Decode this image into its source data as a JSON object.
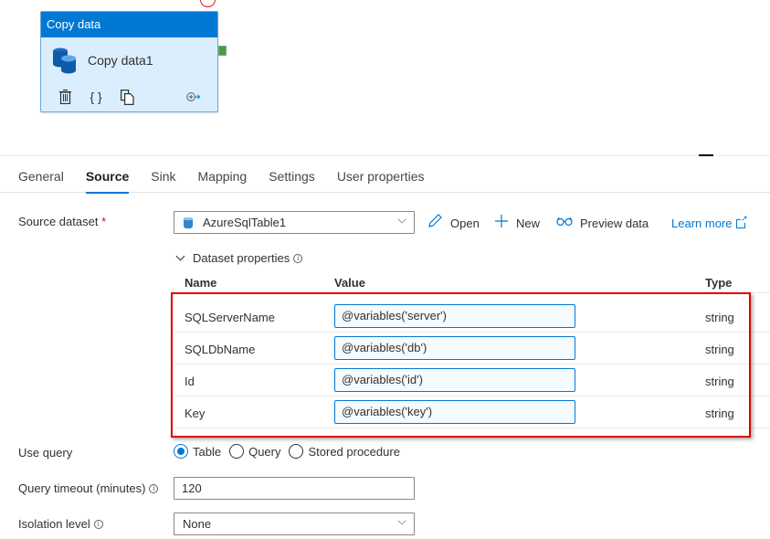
{
  "canvas": {
    "activity": {
      "type_label": "Copy data",
      "name": "Copy data1",
      "actions": [
        {
          "name": "delete",
          "icon": "trash-icon",
          "glyph": "🗑"
        },
        {
          "name": "code",
          "icon": "code-braces-icon",
          "glyph": "{}"
        },
        {
          "name": "clone",
          "icon": "copy-icon",
          "glyph": "⧉"
        },
        {
          "name": "add-output",
          "icon": "add-output-icon",
          "glyph": "⊕→"
        }
      ]
    }
  },
  "tabs": [
    {
      "label": "General",
      "active": false
    },
    {
      "label": "Source",
      "active": true
    },
    {
      "label": "Sink",
      "active": false
    },
    {
      "label": "Mapping",
      "active": false
    },
    {
      "label": "Settings",
      "active": false
    },
    {
      "label": "User properties",
      "active": false
    }
  ],
  "source": {
    "dataset_label": "Source dataset",
    "required_mark": "*",
    "dataset_value": "AzureSqlTable1",
    "commands": {
      "open": "Open",
      "new": "New",
      "preview": "Preview data",
      "learn_more": "Learn more"
    },
    "dataset_properties": {
      "toggle_label": "Dataset properties",
      "headers": {
        "name": "Name",
        "value": "Value",
        "type": "Type"
      },
      "rows": [
        {
          "name": "SQLServerName",
          "value": "@variables('server')",
          "type": "string"
        },
        {
          "name": "SQLDbName",
          "value": "@variables('db')",
          "type": "string"
        },
        {
          "name": "Id",
          "value": "@variables('id')",
          "type": "string"
        },
        {
          "name": "Key",
          "value": "@variables('key')",
          "type": "string"
        }
      ]
    },
    "use_query": {
      "label": "Use query",
      "options": [
        {
          "label": "Table",
          "checked": true
        },
        {
          "label": "Query",
          "checked": false
        },
        {
          "label": "Stored procedure",
          "checked": false
        }
      ]
    },
    "query_timeout": {
      "label": "Query timeout (minutes)",
      "value": "120"
    },
    "isolation_level": {
      "label": "Isolation level",
      "value": "None"
    }
  },
  "colors": {
    "accent": "#0078d4",
    "highlight": "#e00000",
    "node_fill": "#dbeefd",
    "port_green": "#4c9a4c"
  }
}
